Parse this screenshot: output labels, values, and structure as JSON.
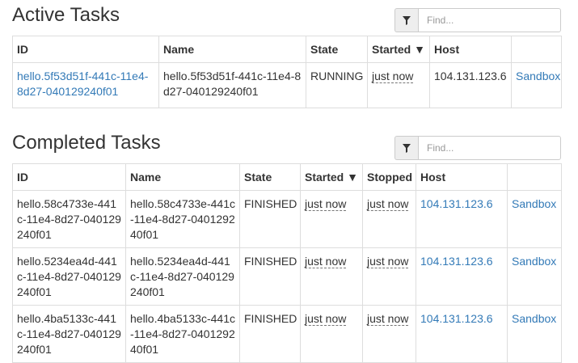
{
  "active": {
    "title": "Active Tasks",
    "filter_placeholder": "Find...",
    "columns": [
      "ID",
      "Name",
      "State",
      "Started ▼",
      "Host",
      ""
    ],
    "rows": [
      {
        "id": "hello.5f53d51f-441c-11e4-8d27-040129240f01",
        "name": "hello.5f53d51f-441c-11e4-8d27-040129240f01",
        "state": "RUNNING",
        "started": "just now",
        "host": "104.131.123.6",
        "sandbox": "Sandbox"
      }
    ]
  },
  "completed": {
    "title": "Completed Tasks",
    "filter_placeholder": "Find...",
    "columns": [
      "ID",
      "Name",
      "State",
      "Started ▼",
      "Stopped",
      "Host",
      ""
    ],
    "rows": [
      {
        "id": "hello.58c4733e-441c-11e4-8d27-040129240f01",
        "name": "hello.58c4733e-441c-11e4-8d27-040129240f01",
        "state": "FINISHED",
        "started": "just now",
        "stopped": "just now",
        "host": "104.131.123.6",
        "sandbox": "Sandbox"
      },
      {
        "id": "hello.5234ea4d-441c-11e4-8d27-040129240f01",
        "name": "hello.5234ea4d-441c-11e4-8d27-040129240f01",
        "state": "FINISHED",
        "started": "just now",
        "stopped": "just now",
        "host": "104.131.123.6",
        "sandbox": "Sandbox"
      },
      {
        "id": "hello.4ba5133c-441c-11e4-8d27-040129240f01",
        "name": "hello.4ba5133c-441c-11e4-8d27-040129240f01",
        "state": "FINISHED",
        "started": "just now",
        "stopped": "just now",
        "host": "104.131.123.6",
        "sandbox": "Sandbox"
      }
    ]
  },
  "icons": {
    "filter": "filter-icon"
  },
  "colors": {
    "link": "#337ab7",
    "border": "#dddddd",
    "text": "#333333"
  }
}
